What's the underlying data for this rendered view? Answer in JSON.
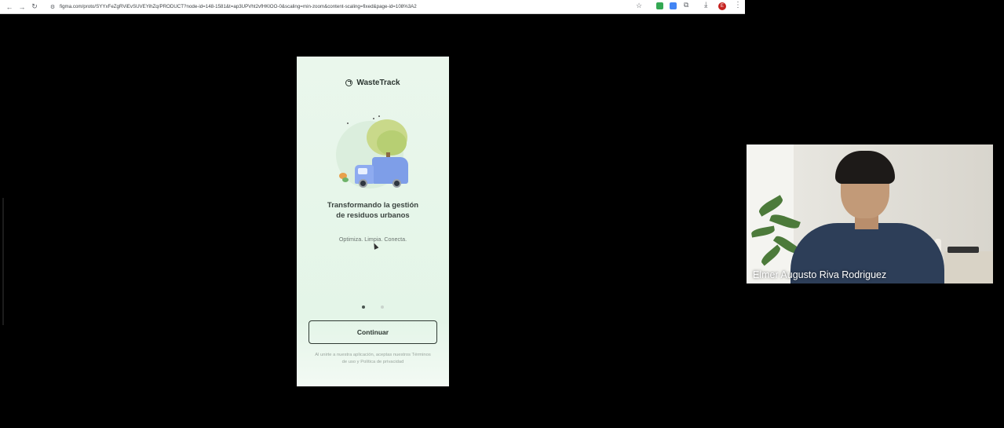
{
  "browser": {
    "back_icon": "←",
    "forward_icon": "→",
    "reload_icon": "↻",
    "site_info_icon": "⚙",
    "url": "figma.com/proto/SYYxFeZgRViEvSUVEYihZq/PRODUCT?node-id=148-1581&t=ap3UPVht2vfHKlOO-0&scaling=min-zoom&content-scaling=fixed&page-id=108%3A2",
    "star_icon": "☆",
    "puzzle_icon": "⧉",
    "download_icon": "⤓",
    "profile_initial": "E",
    "menu_icon": "⋮"
  },
  "prototype": {
    "brand_name": "WasteTrack",
    "headline_line1": "Transformando la gestión",
    "headline_line2": "de residuos urbanos",
    "tagline": "Optimiza. Limpia. Conecta.",
    "pagination": {
      "total": 2,
      "active": 1
    },
    "continue_label": "Continuar",
    "legal_line1": "Al unirte a nuestra aplicación, aceptas nuestros Términos",
    "legal_line2": "de uso y Política de privacidad"
  },
  "video": {
    "participant_name": "Elmer Augusto Riva Rodriguez"
  }
}
